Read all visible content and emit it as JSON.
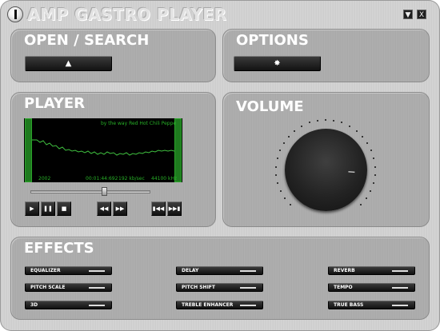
{
  "window": {
    "title": "AMP GASTRO PLAYER",
    "minimize_glyph": "▼",
    "close_glyph": "X"
  },
  "open_search": {
    "title": "OPEN / SEARCH",
    "button_glyph": "▲"
  },
  "options": {
    "title": "OPTIONS",
    "button_glyph": "✸"
  },
  "player": {
    "title": "PLAYER",
    "track": "by the way Red Hot Chili Peppe",
    "year": "2002",
    "time": "00:01:44:692",
    "bitrate": "192 kb/sec",
    "samplerate": "44100 kHz",
    "seek_position": 0.62,
    "buttons": {
      "play": "▶",
      "pause": "❚❚",
      "stop": "■",
      "rewind": "◀◀",
      "forward": "▶▶",
      "prev": "▮◀◀",
      "next": "▶▶▮"
    }
  },
  "volume": {
    "title": "VOLUME",
    "level": 0.85
  },
  "effects": {
    "title": "EFFECTS",
    "items": [
      {
        "label": "EQUALIZER"
      },
      {
        "label": "PITCH SCALE"
      },
      {
        "label": "3D"
      },
      {
        "label": "DELAY"
      },
      {
        "label": "PITCH SHIFT"
      },
      {
        "label": "TREBLE ENHANCER"
      },
      {
        "label": "REVERB"
      },
      {
        "label": "TEMPO"
      },
      {
        "label": "TRUE BASS"
      }
    ]
  }
}
